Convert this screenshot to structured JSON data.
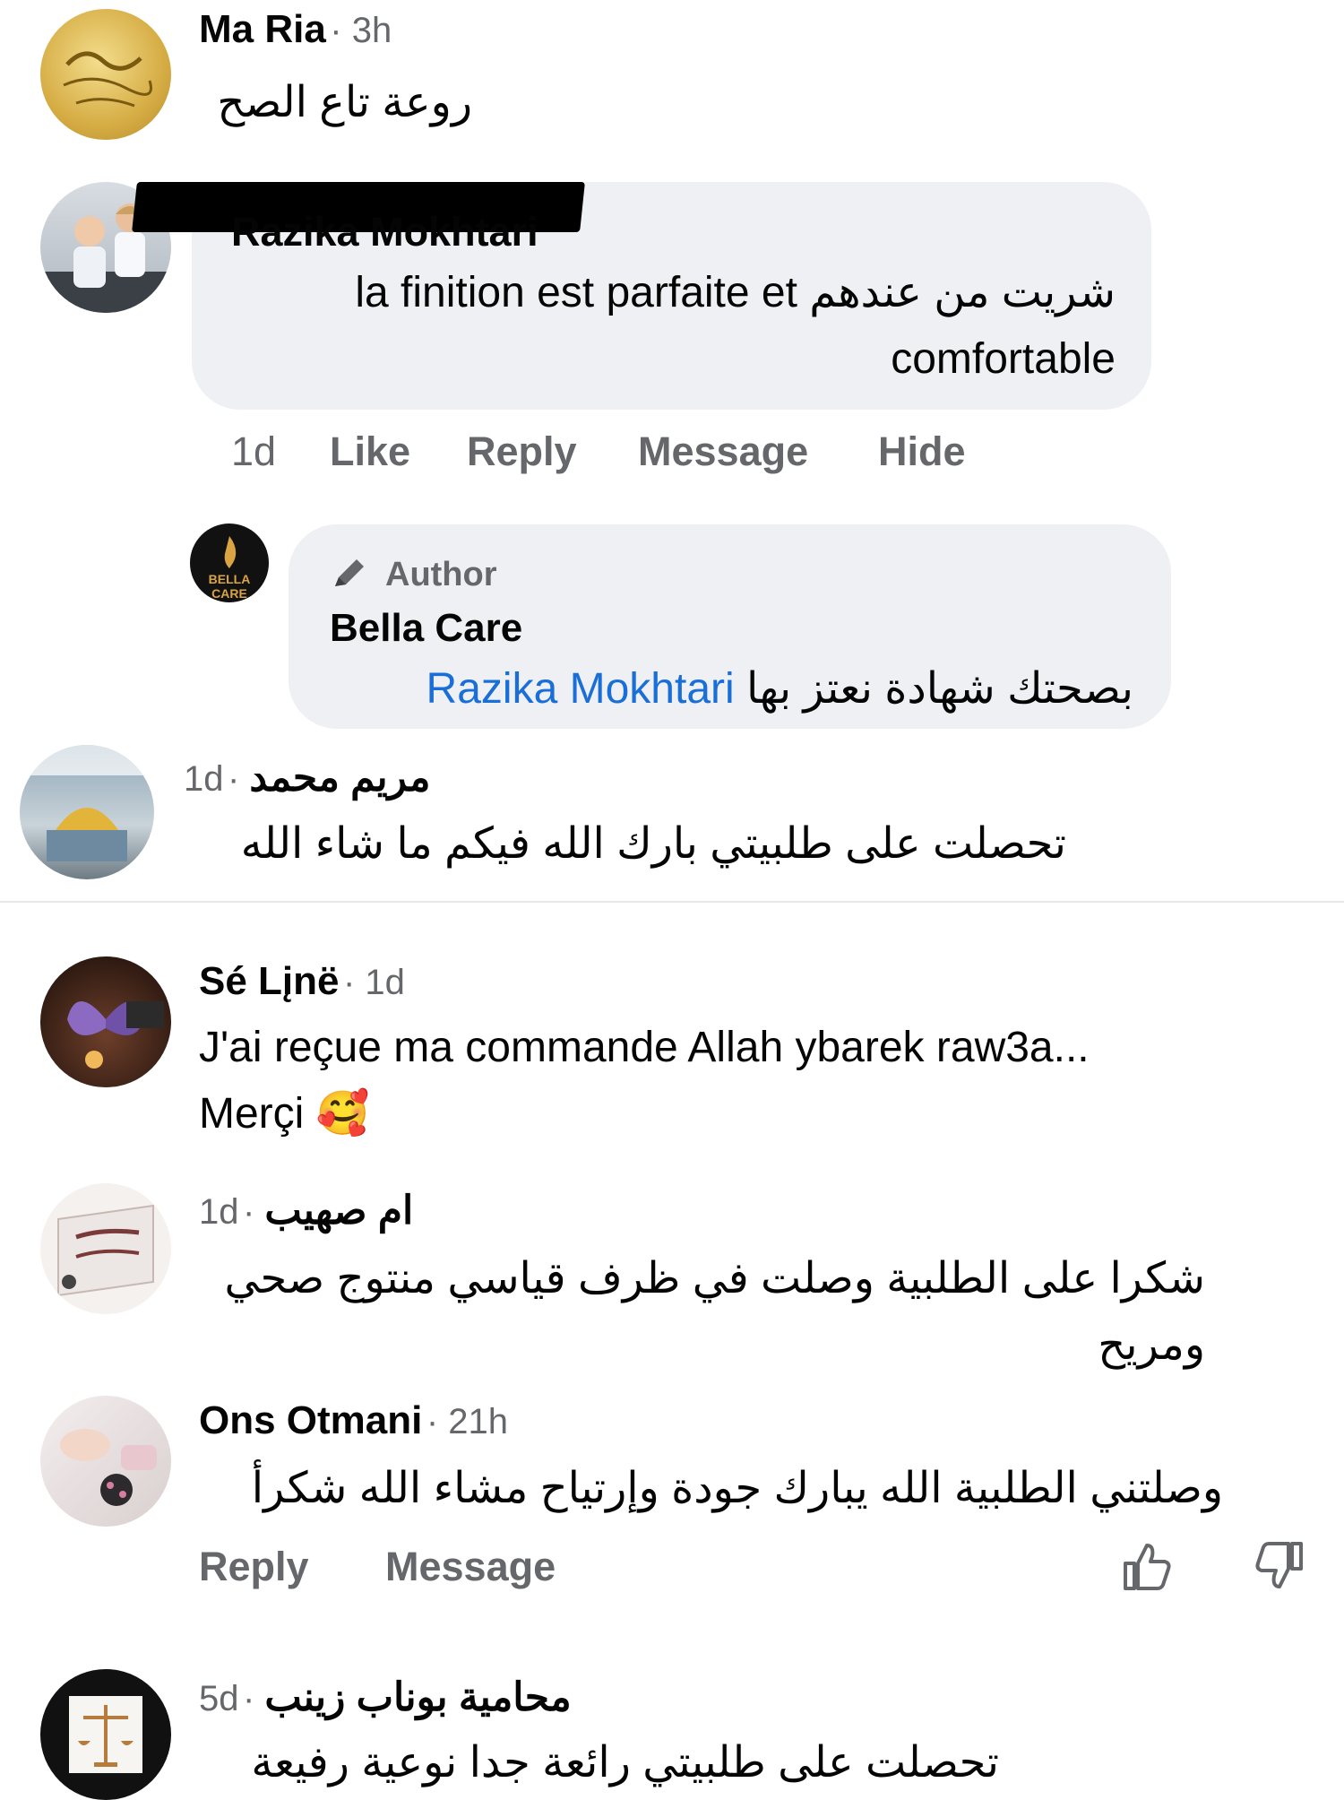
{
  "comments": [
    {
      "name": "Ma Ria",
      "time": "3h",
      "text": "روعة تاع الصح",
      "avatar": "calligraphy-avatar"
    },
    {
      "name": "Razika Mokhtari",
      "time": "1d",
      "text_ar": "شريت من عندهم",
      "text_fr_1": "la finition est parfaite et",
      "text_fr_2": "comfortable",
      "actions": [
        "Like",
        "Reply",
        "Message",
        "Hide"
      ],
      "avatar": "children-avatar"
    },
    {
      "badge": "Author",
      "name": "Bella Care",
      "text_ar": "بصحتك شهادة نعتز بها",
      "mention": "Razika Mokhtari",
      "avatar_text": "BELLA CARE"
    },
    {
      "name": "مريم محمد",
      "time": "1d",
      "text": "تحصلت على طلبيتي بارك الله فيكم ما شاء الله",
      "avatar": "mosque-avatar"
    },
    {
      "name": "Sé Lįnë",
      "time": "1d",
      "text_1": "J'ai reçue ma commande Allah ybarek raw3a...",
      "text_2": "Merçi",
      "emoji": "🥰",
      "avatar": "butterfly-avatar"
    },
    {
      "name": "ام صهيب",
      "time": "1d",
      "text_1": "شكرا على الطلبية وصلت في ظرف قياسي منتوج صحي",
      "text_2": "ومريح",
      "avatar": "quran-avatar"
    },
    {
      "name": "Ons Otmani",
      "time": "21h",
      "text": "وصلتني الطلبية الله يبارك  جودة وإرتياح مشاء الله شكرأ",
      "actions": [
        "Reply",
        "Message"
      ],
      "avatar": "hands-avatar"
    },
    {
      "name": "محامية  بوناب زينب",
      "time": "5d",
      "text": "تحصلت على طلبيتي رائعة جدا نوعية رفيعة",
      "avatar": "scales-avatar"
    }
  ],
  "colors": {
    "bubble": "#eef0f3",
    "secondary_text": "#65676b",
    "link": "#1a6ed8",
    "redaction": "#000000"
  }
}
